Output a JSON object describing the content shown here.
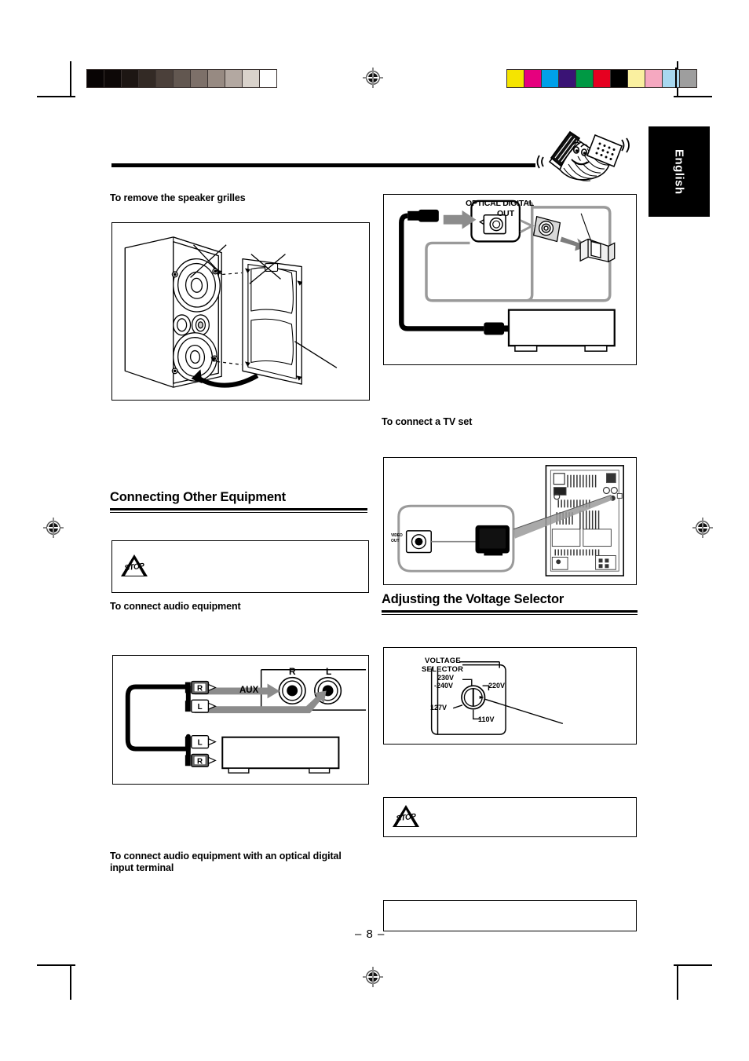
{
  "page": {
    "number": "– 8 –",
    "language_tab": "English",
    "mascot": "accordion-mascot"
  },
  "calibration": {
    "gray_wedge": [
      "#080404",
      "#0d0807",
      "#1d1613",
      "#332a25",
      "#4b403a",
      "#625750",
      "#7d7069",
      "#978a82",
      "#b3a8a1",
      "#d9d2cb",
      "#ffffff"
    ],
    "color_bars": [
      "#f5e400",
      "#e6007e",
      "#00a0e9",
      "#3a1375",
      "#009944",
      "#e60020",
      "#000000",
      "#faf0a0",
      "#f5a8c0",
      "#a8d8f0",
      "#9e9e9e"
    ]
  },
  "left_column": {
    "heading_remove_grilles": "To remove the speaker grilles",
    "section_connecting": "Connecting Other Equipment",
    "heading_connect_audio": "To connect audio equipment",
    "heading_connect_optical": "To connect audio equipment with an optical digital input terminal",
    "caution_icon": "stop-caution-icon",
    "caution_word": "STOP"
  },
  "right_column": {
    "heading_connect_tv": "To connect a TV set",
    "section_voltage": "Adjusting the Voltage Selector",
    "caution_icon": "stop-caution-icon",
    "caution_word": "STOP"
  },
  "fig_optical": {
    "terminal_label_line1": "OPTICAL DIGITAL",
    "terminal_label_line2": "OUT"
  },
  "fig_aux": {
    "aux_label": "AUX",
    "jack_right": "R",
    "jack_left": "L",
    "plug_top_right": "R",
    "plug_top_left": "L",
    "plug_bottom_left": "L",
    "plug_bottom_right": "R"
  },
  "fig_tv": {
    "jack_label_line1": "VIDEO",
    "jack_label_line2": "OUT"
  },
  "fig_voltage": {
    "title_line1": "VOLTAGE",
    "title_line2": "SELECTOR",
    "options": [
      "230V",
      "-240V",
      "220V",
      "127V",
      "110V"
    ]
  }
}
